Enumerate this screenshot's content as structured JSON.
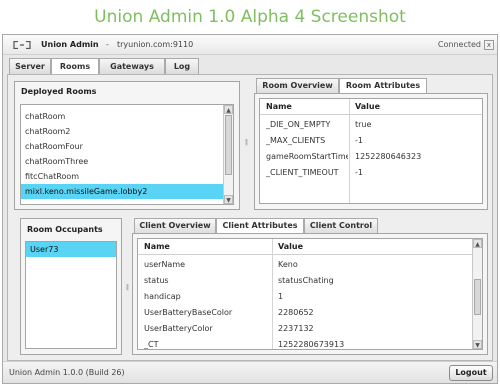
{
  "page": {
    "title": "Union Admin 1.0 Alpha 4 Screenshot"
  },
  "header": {
    "app_name": "Union Admin",
    "separator": "-",
    "server_address": "tryunion.com:9110",
    "connection_status": "Connected",
    "close_glyph": "x"
  },
  "tabs": [
    {
      "label": "Server",
      "active": false
    },
    {
      "label": "Rooms",
      "active": true
    },
    {
      "label": "Gateways",
      "active": false
    },
    {
      "label": "Log",
      "active": false
    }
  ],
  "deployed_rooms": {
    "title": "Deployed Rooms",
    "items": [
      "chatRoom",
      "chatRoom2",
      "chatRoomFour",
      "chatRoomThree",
      "fitcChatRoom",
      "mixl.keno.missileGame.lobby2"
    ],
    "selected_index": 5
  },
  "room_panel": {
    "tabs": [
      {
        "label": "Room Overview",
        "active": false
      },
      {
        "label": "Room Attributes",
        "active": true
      }
    ],
    "columns": [
      "Name",
      "Value"
    ],
    "rows": [
      {
        "name": "_DIE_ON_EMPTY",
        "value": "true"
      },
      {
        "name": "_MAX_CLIENTS",
        "value": "-1"
      },
      {
        "name": "gameRoomStartTime",
        "value": "1252280646323"
      },
      {
        "name": "_CLIENT_TIMEOUT",
        "value": "-1"
      }
    ]
  },
  "occupants": {
    "title": "Room Occupants",
    "items": [
      "User73"
    ],
    "selected_index": 0
  },
  "client_panel": {
    "tabs": [
      {
        "label": "Client Overview",
        "active": false
      },
      {
        "label": "Client Attributes",
        "active": true
      },
      {
        "label": "Client Control",
        "active": false
      }
    ],
    "columns": [
      "Name",
      "Value"
    ],
    "rows": [
      {
        "name": "userName",
        "value": "Keno"
      },
      {
        "name": "status",
        "value": "statusChating"
      },
      {
        "name": "handicap",
        "value": "1"
      },
      {
        "name": "UserBatteryBaseColor",
        "value": "2280652"
      },
      {
        "name": "UserBatteryColor",
        "value": "2237132"
      },
      {
        "name": "_CT",
        "value": "1252280673913"
      }
    ]
  },
  "status_bar": {
    "build": "Union Admin 1.0.0 (Build 26)",
    "logout_label": "Logout"
  },
  "icons": {
    "logo": "union-logo-icon",
    "scroll_up": "▲",
    "scroll_down": "▼",
    "splitter": "‖"
  },
  "colors": {
    "title_green": "#7fbf5f",
    "selection_cyan": "#5ad4f4"
  }
}
